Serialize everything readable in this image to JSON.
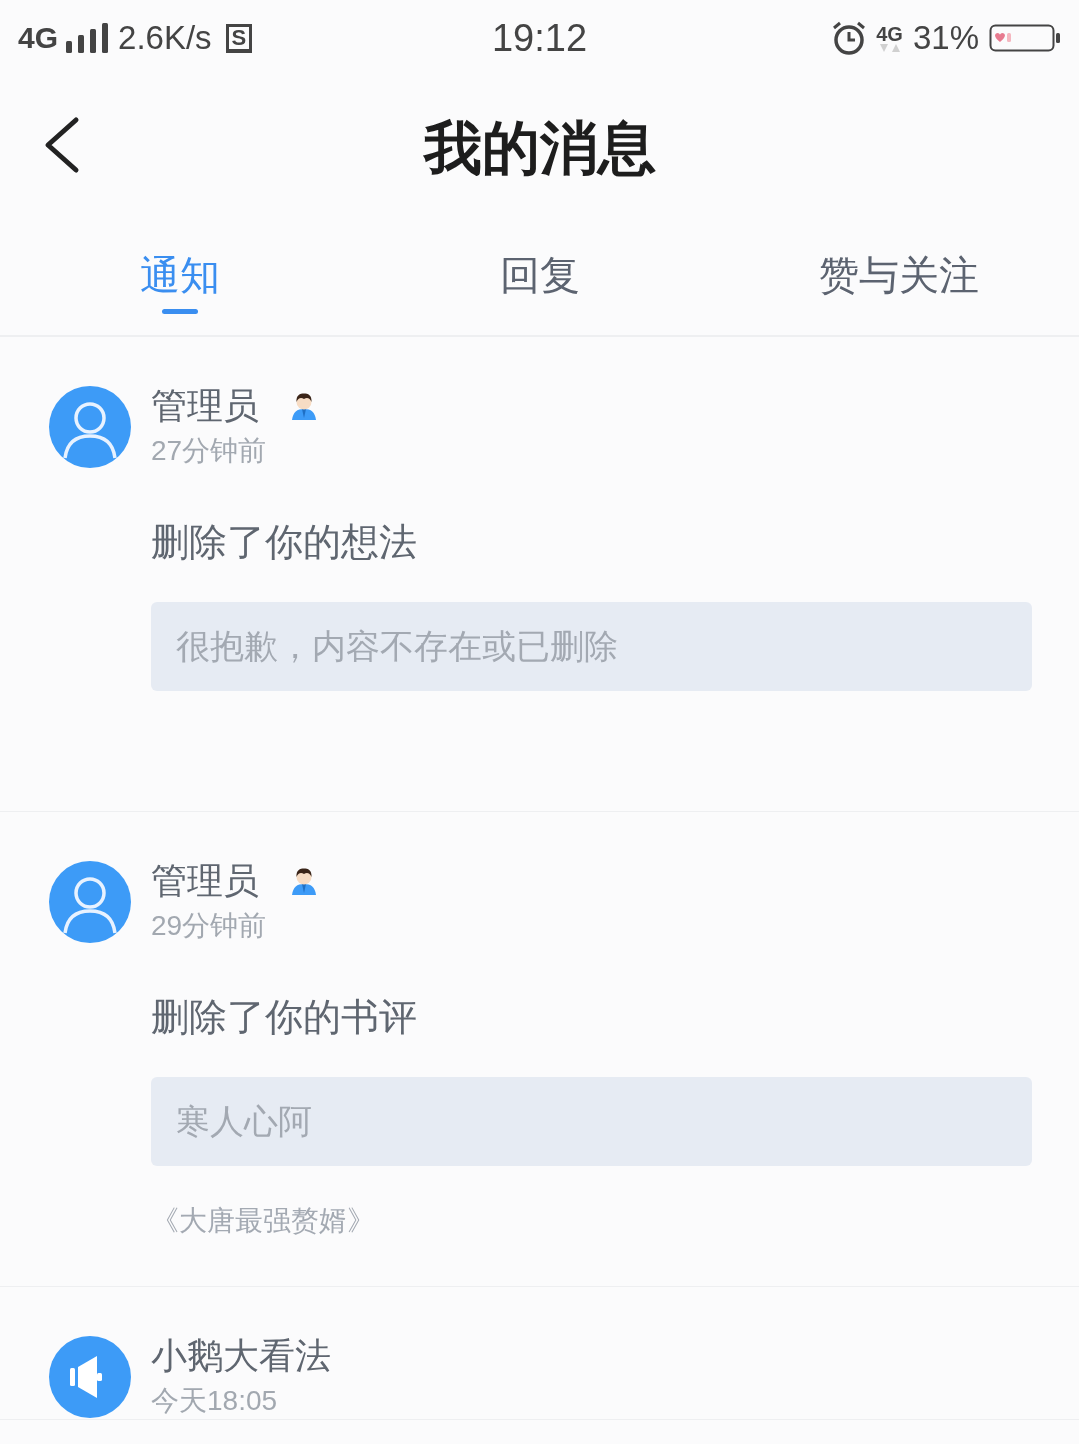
{
  "status_bar": {
    "network": "4G",
    "speed": "2.6K/s",
    "s_badge": "S",
    "time": "19:12",
    "network_right": "4G",
    "battery": "31%"
  },
  "header": {
    "title": "我的消息"
  },
  "tabs": [
    {
      "label": "通知",
      "selected": true
    },
    {
      "label": "回复",
      "selected": false
    },
    {
      "label": "赞与关注",
      "selected": false
    }
  ],
  "messages": [
    {
      "kind": "admin",
      "name": "管理员",
      "time": "27分钟前",
      "action": "删除了你的想法",
      "quote": "很抱歉，内容不存在或已删除"
    },
    {
      "kind": "admin",
      "name": "管理员",
      "time": "29分钟前",
      "action": "删除了你的书评",
      "quote": "寒人心阿",
      "book": "《大唐最强赘婿》"
    },
    {
      "kind": "announcement",
      "name": "小鹅大看法",
      "time": "今天18:05"
    }
  ]
}
